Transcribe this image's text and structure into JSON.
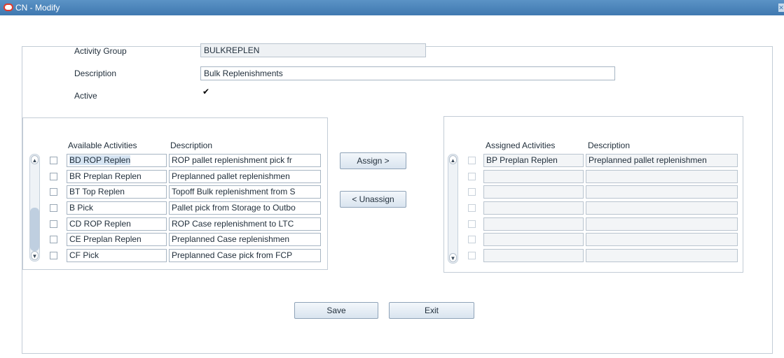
{
  "window": {
    "title": "CN - Modify"
  },
  "form": {
    "activity_group_label": "Activity Group",
    "activity_group_value": "BULKREPLEN",
    "description_label": "Description",
    "description_value": "Bulk Replenishments",
    "active_label": "Active",
    "active_checked": "✔"
  },
  "available": {
    "col_activity": "Available Activities",
    "col_description": "Description",
    "rows": [
      {
        "activity": "BD ROP Replen",
        "description": "ROP pallet replenishment pick fr"
      },
      {
        "activity": "BR Preplan Replen",
        "description": "Preplanned pallet replenishmen"
      },
      {
        "activity": "BT Top Replen",
        "description": "Topoff Bulk replenishment from S"
      },
      {
        "activity": "B Pick",
        "description": "Pallet pick from Storage to Outbo"
      },
      {
        "activity": "CD ROP Replen",
        "description": "ROP Case replenishment to LTC"
      },
      {
        "activity": "CE Preplan Replen",
        "description": "Preplanned Case replenishmen"
      },
      {
        "activity": "CF Pick",
        "description": "Preplanned Case pick from FCP"
      }
    ]
  },
  "assigned": {
    "col_activity": "Assigned Activities",
    "col_description": "Description",
    "rows": [
      {
        "activity": "BP Preplan Replen",
        "description": "Preplanned pallet replenishmen"
      },
      {
        "activity": "",
        "description": ""
      },
      {
        "activity": "",
        "description": ""
      },
      {
        "activity": "",
        "description": ""
      },
      {
        "activity": "",
        "description": ""
      },
      {
        "activity": "",
        "description": ""
      },
      {
        "activity": "",
        "description": ""
      }
    ]
  },
  "buttons": {
    "assign": "Assign >",
    "unassign": "< Unassign",
    "save": "Save",
    "exit": "Exit"
  },
  "colors": {
    "titlebar": "#4a84bb",
    "logo": "#e03a2b"
  }
}
